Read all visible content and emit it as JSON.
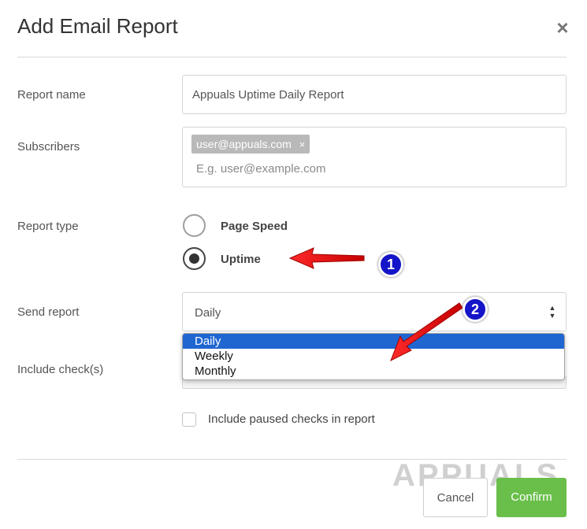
{
  "dialog": {
    "title": "Add Email Report",
    "close_glyph": "×"
  },
  "form": {
    "report_name": {
      "label": "Report name",
      "value": "Appuals Uptime Daily Report"
    },
    "subscribers": {
      "label": "Subscribers",
      "tags": [
        "user@appuals.com"
      ],
      "tag_remove_glyph": "×",
      "placeholder": "E.g. user@example.com"
    },
    "report_type": {
      "label": "Report type",
      "options": [
        {
          "label": "Page Speed",
          "checked": false
        },
        {
          "label": "Uptime",
          "checked": true
        }
      ]
    },
    "send_report": {
      "label": "Send report",
      "selected": "Daily",
      "options": [
        "Daily",
        "Weekly",
        "Monthly"
      ]
    },
    "include_checks": {
      "label": "Include check(s)"
    },
    "include_paused": {
      "label": "Include paused checks in report",
      "checked": false
    }
  },
  "buttons": {
    "cancel": "Cancel",
    "confirm": "Confirm"
  },
  "annotations": {
    "badge_1": "1",
    "badge_2": "2"
  },
  "watermark": "APPUALS",
  "colors": {
    "confirm": "#6abf4b",
    "selected_option": "#1f66d1",
    "arrow": "#e01010",
    "badge": "#1414c8"
  }
}
